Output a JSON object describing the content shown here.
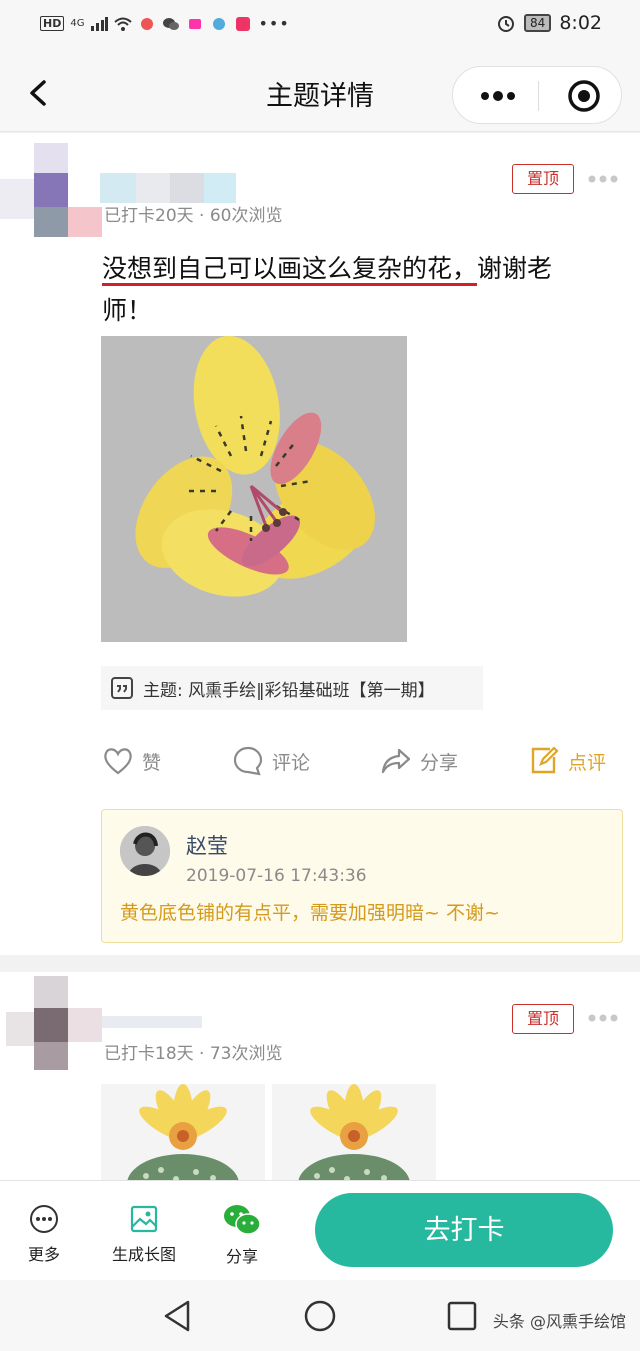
{
  "status_bar": {
    "time": "8:02",
    "battery": "84",
    "network": "4G"
  },
  "nav": {
    "title": "主题详情"
  },
  "post1": {
    "pin_label": "置顶",
    "meta": "已打卡20天 · 60次浏览",
    "text_highlight": "没想到自己可以画这么复杂的花，",
    "text_rest": "谢谢老师！",
    "topic": "主题: 风熏手绘‖彩铅基础班【第一期】",
    "actions": {
      "like": "赞",
      "comment": "评论",
      "share": "分享",
      "review": "点评"
    },
    "comment": {
      "name": "赵莹",
      "time": "2019-07-16 17:43:36",
      "text": "黄色底色铺的有点平，需要加强明暗~ 不谢~"
    }
  },
  "post2": {
    "pin_label": "置顶",
    "meta": "已打卡18天 · 73次浏览"
  },
  "toolbar": {
    "more": "更多",
    "long_image": "生成长图",
    "share": "分享",
    "checkin": "去打卡"
  },
  "watermark": "头条 @风熏手绘馆",
  "colors": {
    "accent": "#26b9a0",
    "pin": "#c9302c",
    "review": "#e0a528",
    "comment_bg": "#fffbea"
  }
}
